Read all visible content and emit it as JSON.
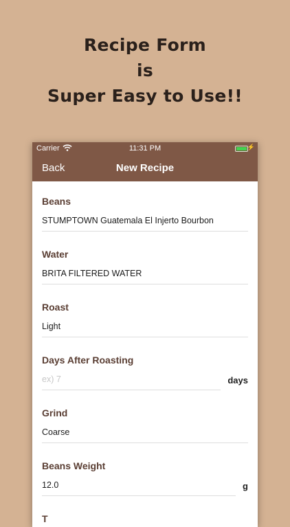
{
  "promo": {
    "line1": "Recipe Form",
    "line2": "is",
    "line3": "Super Easy to Use!!"
  },
  "statusbar": {
    "carrier": "Carrier",
    "time": "11:31 PM",
    "wifi_icon": "wifi-icon",
    "battery_icon": "battery-icon",
    "battery_level": 1.0,
    "colors": {
      "battery": "#43d250"
    }
  },
  "nav": {
    "back_label": "Back",
    "title": "New Recipe",
    "colors": {
      "bar": "#7f5846"
    }
  },
  "form": {
    "beans": {
      "label": "Beans",
      "value": "STUMPTOWN Guatemala El Injerto Bourbon"
    },
    "water": {
      "label": "Water",
      "value": "BRITA FILTERED WATER"
    },
    "roast": {
      "label": "Roast",
      "value": "Light"
    },
    "days_after_roasting": {
      "label": "Days After Roasting",
      "placeholder": "ex) 7",
      "unit": "days"
    },
    "grind": {
      "label": "Grind",
      "value": "Coarse"
    },
    "beans_weight": {
      "label": "Beans Weight",
      "value": "12.0",
      "unit": "g"
    },
    "next": {
      "label": "T"
    }
  },
  "colors": {
    "background": "#d4b293",
    "label": "#5a3e33"
  }
}
